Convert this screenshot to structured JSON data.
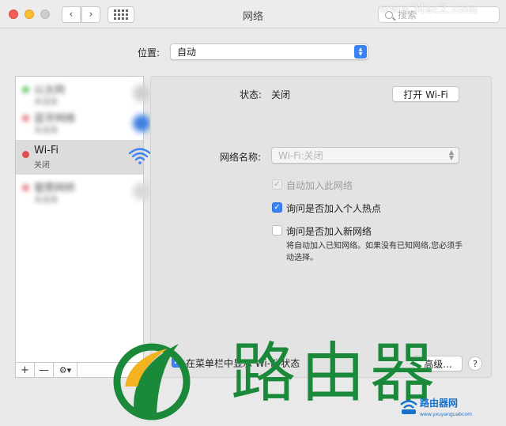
{
  "window": {
    "title": "网络"
  },
  "search": {
    "placeholder": "搜索"
  },
  "watermark_top": "www.MacZ.com",
  "location": {
    "label": "位置:",
    "value": "自动"
  },
  "services": [
    {
      "name": "以太网",
      "status": "未连接",
      "color": "#49b94a"
    },
    {
      "name": "蓝牙网络",
      "status": "未连接",
      "color": "#e06060"
    },
    {
      "name": "Wi-Fi",
      "status": "关闭",
      "color": "#e04d4d"
    },
    {
      "name": "雷雳网桥",
      "status": "未连接",
      "color": "#e06060"
    }
  ],
  "sidebar_bottom": {
    "add": "+",
    "remove": "—",
    "gear": "⚙▾"
  },
  "detail": {
    "status_label": "状态:",
    "status_value": "关闭",
    "toggle_button": "打开 Wi-Fi",
    "network_name_label": "网络名称:",
    "network_name_value": "Wi-Fi:关闭",
    "auto_join_label": "自动加入此网络",
    "ask_hotspot_label": "询问是否加入个人热点",
    "ask_new_label": "询问是否加入新网络",
    "note": "将自动加入已知网络。如果没有已知网络,您必须手动选择。",
    "menubar_label": "在菜单栏中显示 Wi-Fi 状态",
    "advanced_button": "高级...",
    "help": "?"
  },
  "checkboxes": {
    "auto_join": true,
    "ask_hotspot": true,
    "ask_new": false,
    "menubar": true
  },
  "overlay": {
    "brand": "路由器",
    "site": "路由器网",
    "site_url": "www.yxuyanguabcom"
  }
}
